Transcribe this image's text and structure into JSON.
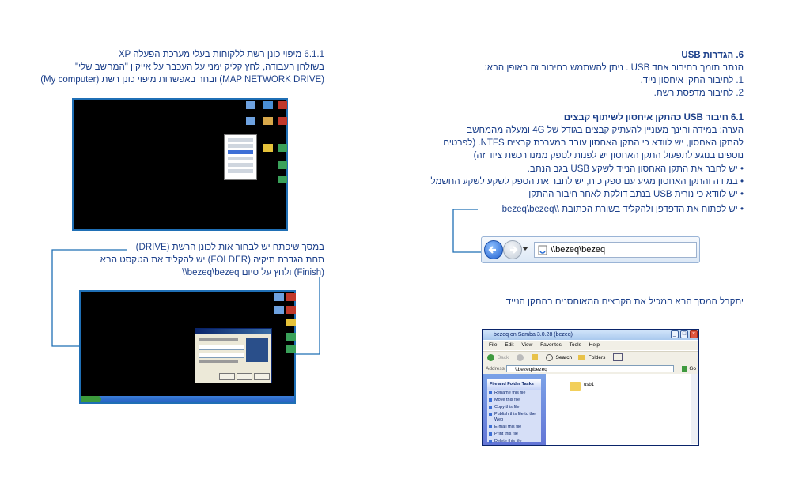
{
  "right_column": {
    "section6_title": "6. הגדרות USB",
    "section6_intro": "הנתב תומך בחיבור אחד USB . ניתן להשתמש בחיבור זה באופן הבא:",
    "section6_items": [
      "1. לחיבור התקן איחסון נייד.",
      "2. לחיבור מדפסת רשת."
    ],
    "section61_title": "6.1 חיבור USB כהתקן איחסון לשיתוף קבצים",
    "note_lines": [
      "הערה: במידה והינך מעוניין להעתיק קבצים בגודל של 4G ומעלה מהמחשב",
      "להתקן האחסון, יש לוודא כי התקן האחסון עובד במערכת קבצים NTFS. (לפרטים",
      "נוספים בנוגע לתפעול התקן האחסון יש לפנות לספק ממנו רכשת ציוד זה)"
    ],
    "bullets": [
      "• יש לחבר את התקן האחסון הנייד לשקע USB בגב הנתב.",
      "• במידה והתקן האחסון מגיע עם ספק כוח, יש לחבר את הספק לשקע לשקע החשמל",
      "• יש לוודא כי נורית USB בנתב דולקת לאחר חיבור ההתקן",
      "• יש לפתוח את הדפדפן ולהקליד בשורת הכתובת \\\\bezeq\\bezeq"
    ],
    "address_value": "\\\\bezeq\\bezeq",
    "screen_caption": "יתקבל המסך הבא המכיל את הקבצים המאוחסנים בהתקן הנייד"
  },
  "left_column": {
    "xp_title": "6.1.1 מיפוי כונן רשת ללקוחות בעלי מערכת הפעלה XP",
    "xp_lines": [
      "בשולחן העבודה, לחץ קליק ימני על העכבר על אייקון \"המחשב שלי\"",
      "(My computer) ובחר באפשרות מיפוי כונן רשת (MAP NETWORK DRIVE)"
    ],
    "drive_lines": [
      "במסך שיפתח יש לבחור אות לכונן הרשת (DRIVE)",
      "תחת הגדרת תיקיה (FOLDER) יש להקליד את הטקסט הבא",
      "\\\\bezeq\\bezeq ולחץ על סיום (Finish)"
    ]
  },
  "explorer": {
    "title": "bezeq on Samba 3.0.28 (bezeq)",
    "menu": [
      "File",
      "Edit",
      "View",
      "Favorites",
      "Tools",
      "Help"
    ],
    "toolbar": [
      "Back",
      "Search",
      "Folders"
    ],
    "address_label": "Address",
    "address_value": "\\\\bezeq\\bezeq",
    "go_label": "Go",
    "tasks_title": "File and Folder Tasks",
    "tasks": [
      "Rename this file",
      "Move this file",
      "Copy this file",
      "Publish this file to the Web",
      "E-mail this file",
      "Print this file",
      "Delete this file"
    ],
    "folder_name": "usb1"
  },
  "colors": {
    "text": "#1b3f8a",
    "callout_line": "#1f6fb5"
  }
}
